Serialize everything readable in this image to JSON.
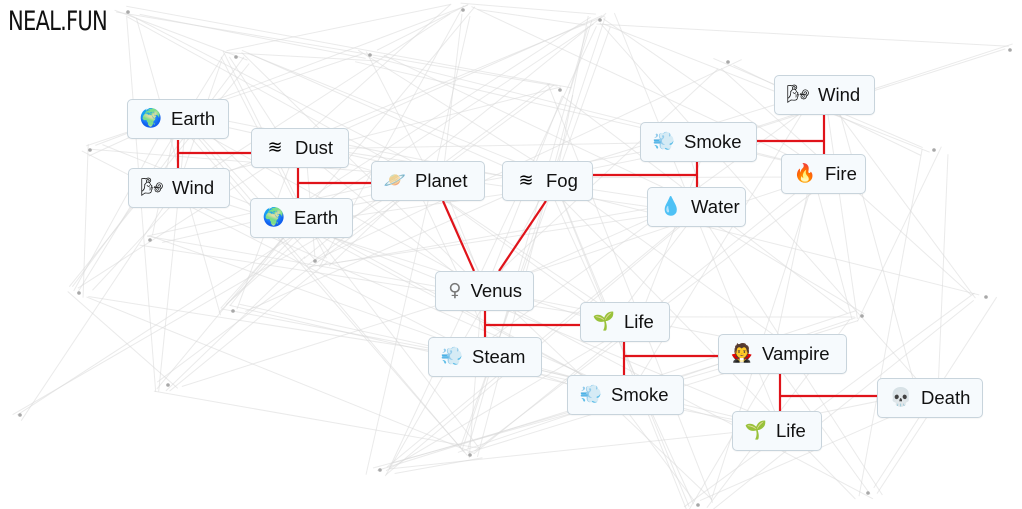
{
  "brand": {
    "logo_text": "NEAL.FUN"
  },
  "colors": {
    "recipe_line": "#e0131a",
    "edge": "#d9d9d9",
    "tile_bg": "#f6fafd",
    "tile_border": "#c8d4dc",
    "dot": "#a8a8a8"
  },
  "elements": [
    {
      "id": "earth-1",
      "emoji": "🌍",
      "icon": "globe-icon",
      "label": "Earth"
    },
    {
      "id": "wind-1",
      "emoji": "🌬",
      "icon": "wind-face-icon",
      "label": "Wind"
    },
    {
      "id": "dust",
      "emoji": "≋",
      "icon": "wavy-lines-icon",
      "label": "Dust"
    },
    {
      "id": "earth-2",
      "emoji": "🌍",
      "icon": "globe-icon",
      "label": "Earth"
    },
    {
      "id": "planet",
      "emoji": "🪐",
      "icon": "ringed-planet-icon",
      "label": "Planet"
    },
    {
      "id": "fog",
      "emoji": "≋",
      "icon": "wavy-lines-icon",
      "label": "Fog"
    },
    {
      "id": "smoke-1",
      "emoji": "💨",
      "icon": "dash-puff-icon",
      "label": "Smoke"
    },
    {
      "id": "water",
      "emoji": "💧",
      "icon": "droplet-icon",
      "label": "Water"
    },
    {
      "id": "wind-2",
      "emoji": "🌬",
      "icon": "wind-face-icon",
      "label": "Wind"
    },
    {
      "id": "fire",
      "emoji": "🔥",
      "icon": "fire-icon",
      "label": "Fire"
    },
    {
      "id": "venus",
      "emoji": "♀",
      "icon": "female-sign-icon",
      "label": "Venus"
    },
    {
      "id": "steam",
      "emoji": "💨",
      "icon": "dash-puff-icon",
      "label": "Steam"
    },
    {
      "id": "life-1",
      "emoji": "🌱",
      "icon": "seedling-icon",
      "label": "Life"
    },
    {
      "id": "smoke-2",
      "emoji": "💨",
      "icon": "dash-puff-icon",
      "label": "Smoke"
    },
    {
      "id": "vampire",
      "emoji": "🧛",
      "icon": "vampire-icon",
      "label": "Vampire"
    },
    {
      "id": "life-2",
      "emoji": "🌱",
      "icon": "seedling-icon",
      "label": "Life"
    },
    {
      "id": "death",
      "emoji": "💀",
      "icon": "skull-icon",
      "label": "Death"
    }
  ],
  "recipes": [
    {
      "inputs": [
        "earth-1",
        "wind-1"
      ],
      "result": "dust"
    },
    {
      "inputs": [
        "dust",
        "earth-2"
      ],
      "result": "planet"
    },
    {
      "inputs": [
        "planet",
        "fog"
      ],
      "result": "venus"
    },
    {
      "inputs": [
        "smoke-1",
        "water"
      ],
      "result": "fog"
    },
    {
      "inputs": [
        "wind-2",
        "fire"
      ],
      "result": "smoke-1"
    },
    {
      "inputs": [
        "venus",
        "steam"
      ],
      "result": "life-1"
    },
    {
      "inputs": [
        "life-1",
        "smoke-2"
      ],
      "result": "vampire"
    },
    {
      "inputs": [
        "vampire",
        "life-2"
      ],
      "result": "death"
    }
  ]
}
